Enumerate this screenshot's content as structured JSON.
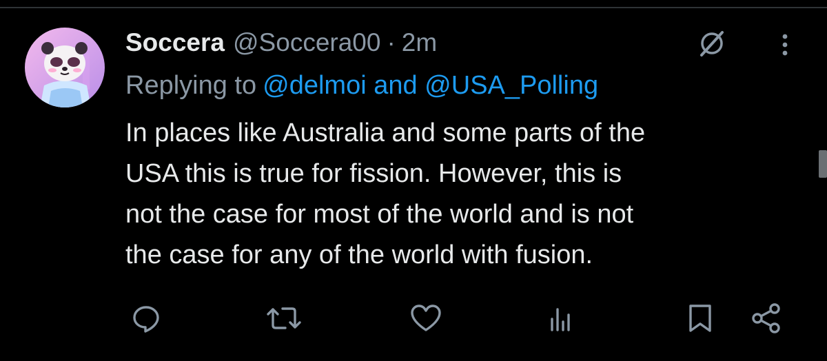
{
  "tweet": {
    "display_name": "Soccera",
    "handle": "@Soccera00",
    "separator": "·",
    "time": "2m",
    "replying_prefix": "Replying to",
    "mention_1": "@delmoi",
    "mention_joiner": "and",
    "mention_2": "@USA_Polling",
    "text_lines": [
      "In places like Australia and some parts of the",
      "USA this is true for fission. However, this is",
      "not the case for most of the world and is not",
      "the case for any of the world with fusion."
    ]
  },
  "icons": {
    "avatar": "panda-avatar",
    "grok": "grok-icon",
    "more": "more-vertical-icon",
    "reply": "reply-icon",
    "retweet": "retweet-icon",
    "like": "heart-icon",
    "views": "views-icon",
    "bookmark": "bookmark-icon",
    "share": "share-icon"
  },
  "colors": {
    "background": "#000000",
    "primary_text": "#e7e9ea",
    "secondary_text": "#8b98a5",
    "link": "#1d9bf0",
    "divider": "#2f3336"
  }
}
